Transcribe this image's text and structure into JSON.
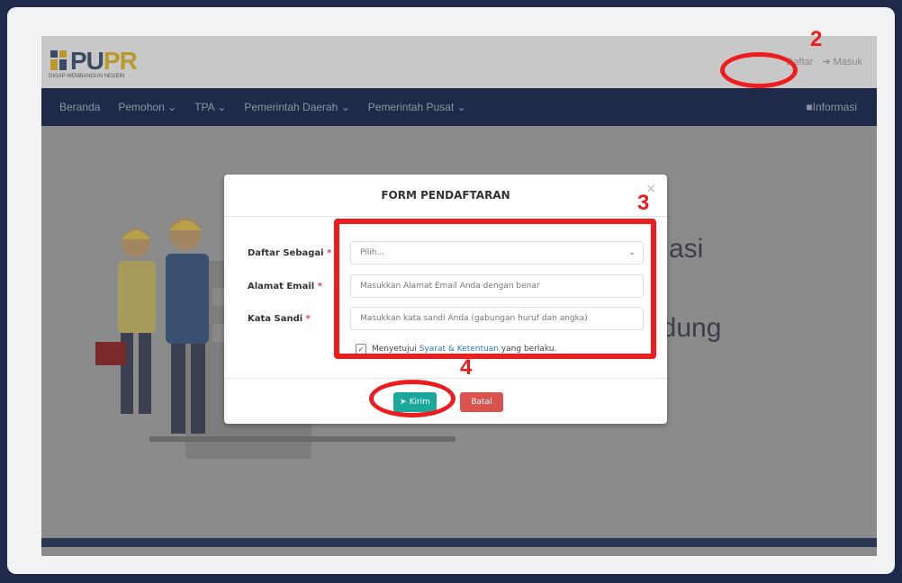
{
  "header": {
    "logo_text_main": "PU",
    "logo_text_accent": "PR",
    "logo_tagline": "DIGAP MEMBANGUN NEGERI",
    "user_link": "Daftar",
    "login_link": "Masuk"
  },
  "nav": {
    "items": [
      "Beranda",
      "Pemohon ⌄",
      "TPA ⌄",
      "Pemerintah Daerah ⌄",
      "Pemerintah Pusat ⌄"
    ],
    "info": "Informasi"
  },
  "background": {
    "text_1": "masi",
    "text_2": "edung"
  },
  "modal": {
    "title": "FORM PENDAFTARAN",
    "close": "×",
    "fields": {
      "daftar_sebagai_label": "Daftar Sebagai",
      "daftar_sebagai_value": "Pilih...",
      "email_label": "Alamat Email",
      "email_placeholder": "Masukkan Alamat Email Anda dengan benar",
      "password_label": "Kata Sandi",
      "password_placeholder": "Masukkan kata sandi Anda (gabungan huruf dan angka)",
      "required_mark": "*"
    },
    "agree": {
      "prefix": "Menyetujui",
      "link": "Syarat & Ketentuan",
      "suffix": "yang berlaku."
    },
    "buttons": {
      "submit": "Kirim",
      "cancel": "Batal"
    }
  },
  "annotations": {
    "n2": "2",
    "n3": "3",
    "n4": "4"
  },
  "colors": {
    "annotation_red": "#ee1c1c",
    "navbar": "#1e2a47",
    "submit_btn": "#1aa89a",
    "cancel_btn": "#d9534f"
  }
}
